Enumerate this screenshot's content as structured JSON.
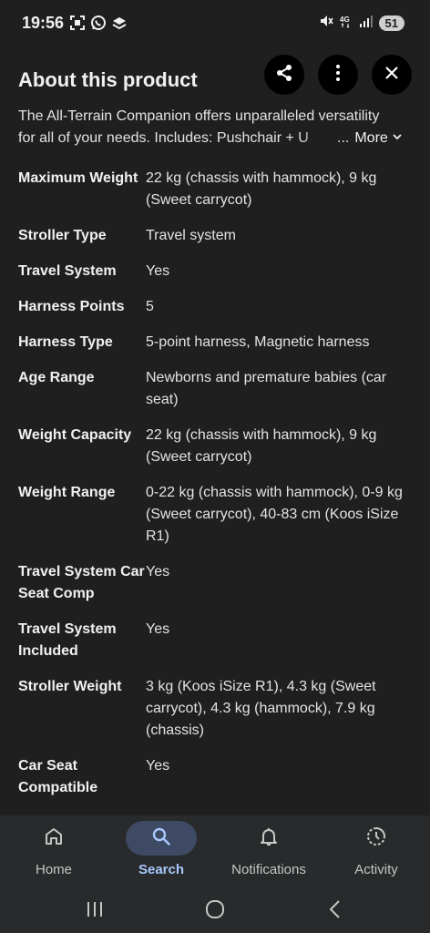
{
  "status_bar": {
    "time": "19:56",
    "left_icons": [
      "screenshot-icon",
      "whatsapp-icon",
      "stack-icon"
    ],
    "right_icons": [
      "mute-icon",
      "4g-icon",
      "signal-icon"
    ],
    "battery": "51"
  },
  "sheet": {
    "title": "About this product",
    "description_line1": "The All-Terrain Companion offers unparalleled versatility",
    "description_line2": "for all of your needs. Includes: Pushchair + U",
    "ellipsis": "...",
    "more_label": "More"
  },
  "specs": [
    {
      "label": "Maximum Weight",
      "value": "22 kg (chassis with hammock), 9 kg (Sweet carrycot)"
    },
    {
      "label": "Stroller Type",
      "value": "Travel system"
    },
    {
      "label": "Travel System",
      "value": "Yes"
    },
    {
      "label": "Harness Points",
      "value": "5"
    },
    {
      "label": "Harness Type",
      "value": "5-point harness, Magnetic harness"
    },
    {
      "label": "Age Range",
      "value": "Newborns and premature babies (car seat)"
    },
    {
      "label": "Weight Capacity",
      "value": "22 kg (chassis with hammock), 9 kg (Sweet carrycot)"
    },
    {
      "label": "Weight Range",
      "value": "0-22 kg (chassis with hammock), 0-9 kg (Sweet carrycot), 40-83 cm (Koos iSize R1)"
    },
    {
      "label": "Travel System Car Seat Comp",
      "value": "Yes"
    },
    {
      "label": "Travel System Included",
      "value": "Yes"
    },
    {
      "label": "Stroller Weight",
      "value": "3 kg (Koos iSize R1), 4.3 kg (Sweet carrycot), 4.3 kg (hammock), 7.9 kg (chassis)"
    },
    {
      "label": "Car Seat Compatible",
      "value": "Yes"
    }
  ],
  "bottom_nav": {
    "items": [
      {
        "label": "Home",
        "icon": "home-icon"
      },
      {
        "label": "Search",
        "icon": "search-icon",
        "active": true
      },
      {
        "label": "Notifications",
        "icon": "bell-icon"
      },
      {
        "label": "Activity",
        "icon": "activity-icon"
      }
    ]
  },
  "colors": {
    "background": "#1f1f1f",
    "nav_background": "#282a2c",
    "active_pill": "#3e4a63",
    "active_text": "#a8c7fa"
  }
}
